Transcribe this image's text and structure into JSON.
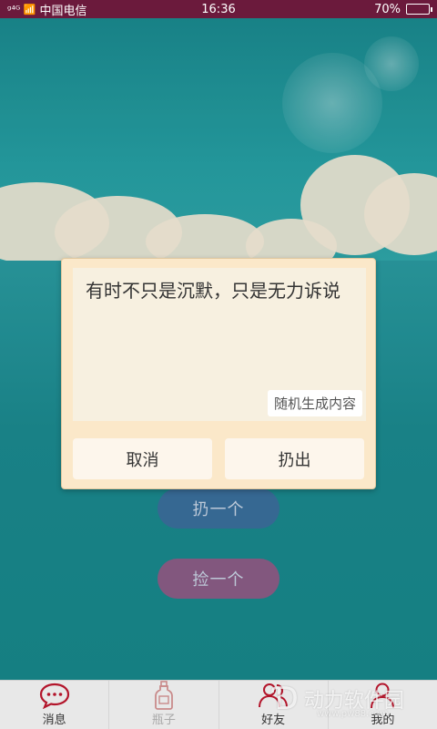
{
  "status": {
    "carrier": "中国电信",
    "signal_prefix": "ᵍ⁴ᴳ 📶",
    "time": "16:36",
    "battery": "70%",
    "battery_level": 0.7
  },
  "dialog": {
    "text": "有时不只是沉默，只是无力诉说",
    "generate_label": "随机生成内容",
    "cancel_label": "取消",
    "throw_label": "扔出"
  },
  "actions": {
    "throw_one": "扔一个",
    "pick_one": "捡一个"
  },
  "tabs": [
    {
      "label": "消息",
      "icon": "message-icon",
      "color": "#b3152b"
    },
    {
      "label": "瓶子",
      "icon": "bottle-icon",
      "color": "#c98a8a"
    },
    {
      "label": "好友",
      "icon": "friends-icon",
      "color": "#b3152b"
    },
    {
      "label": "我的",
      "icon": "profile-icon",
      "color": "#b3152b"
    }
  ],
  "watermark": {
    "text": "动力软件园",
    "url": "www.pw88.com"
  }
}
